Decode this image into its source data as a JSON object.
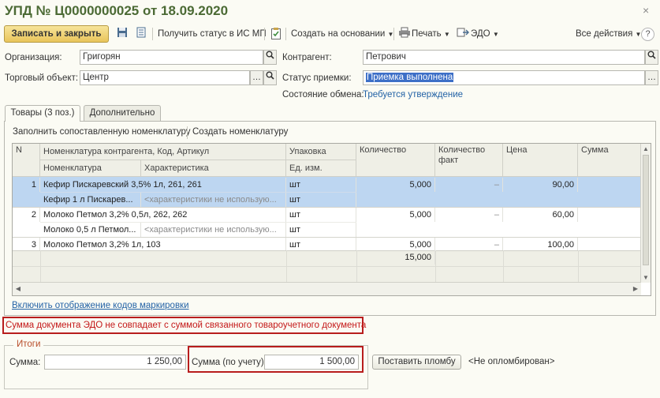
{
  "window": {
    "title": "УПД № Ц0000000025 от 18.09.2020"
  },
  "toolbar": {
    "save_close": "Записать и закрыть",
    "get_status": "Получить статус в ИС МП",
    "create_based": "Создать на основании",
    "print": "Печать",
    "edo": "ЭДО",
    "all_actions": "Все действия",
    "help": "?"
  },
  "form": {
    "organization_label": "Организация:",
    "organization_value": "Григорян",
    "counterparty_label": "Контрагент:",
    "counterparty_value": "Петрович",
    "trade_object_label": "Торговый объект:",
    "trade_object_value": "Центр",
    "accept_status_label": "Статус приемки:",
    "accept_status_value": "Приемка выполнена",
    "exchange_state_label": "Состояние обмена:",
    "exchange_state_value": "Требуется утверждение"
  },
  "tabs": [
    {
      "label": "Товары (3 поз.)",
      "active": true
    },
    {
      "label": "Дополнительно",
      "active": false
    }
  ],
  "table_toolbar": {
    "fill_matched": "Заполнить сопоставленную номенклатуру",
    "create_nomenclature": "Создать номенклатуру"
  },
  "table": {
    "headers": {
      "n": "N",
      "counterparty_nom": "Номенклатура контрагента, Код, Артикул",
      "nomenclature": "Номенклатура",
      "characteristic": "Характеристика",
      "package": "Упаковка",
      "unit": "Ед. изм.",
      "quantity": "Количество",
      "quantity_fact": "Количество факт",
      "price": "Цена",
      "sum": "Сумма"
    },
    "rows": [
      {
        "n": "1",
        "counterparty_nom": "Кефир Пискаревский 3,5% 1л, 261, 261",
        "nomenclature": "Кефир 1 л  Пискарев...",
        "characteristic": "<характеристики не использую...",
        "package": "шт",
        "unit": "шт",
        "quantity": "5,000",
        "quantity_fact": "–",
        "price": "90,00"
      },
      {
        "n": "2",
        "counterparty_nom": "Молоко Петмол 3,2% 0,5л, 262, 262",
        "nomenclature": "Молоко 0,5 л  Петмол...",
        "characteristic": "<характеристики не использую...",
        "package": "шт",
        "unit": "шт",
        "quantity": "5,000",
        "quantity_fact": "–",
        "price": "60,00"
      },
      {
        "n": "3",
        "counterparty_nom": "Молоко Петмол 3,2% 1л, 103",
        "package": "шт",
        "quantity": "5,000",
        "quantity_fact": "–",
        "price": "100,00"
      }
    ],
    "footer_quantity": "15,000"
  },
  "marking_link": "Включить отображение кодов маркировки",
  "error_message": "Сумма документа ЭДО не совпадает с суммой связанного товароучетного документа",
  "totals": {
    "group_title": "Итоги",
    "sum_label": "Сумма:",
    "sum_value": "1 250,00",
    "sum_accounting_label": "Сумма (по учету):",
    "sum_accounting_value": "1 500,00",
    "seal_button": "Поставить пломбу",
    "seal_status": "<Не опломбирован>"
  }
}
